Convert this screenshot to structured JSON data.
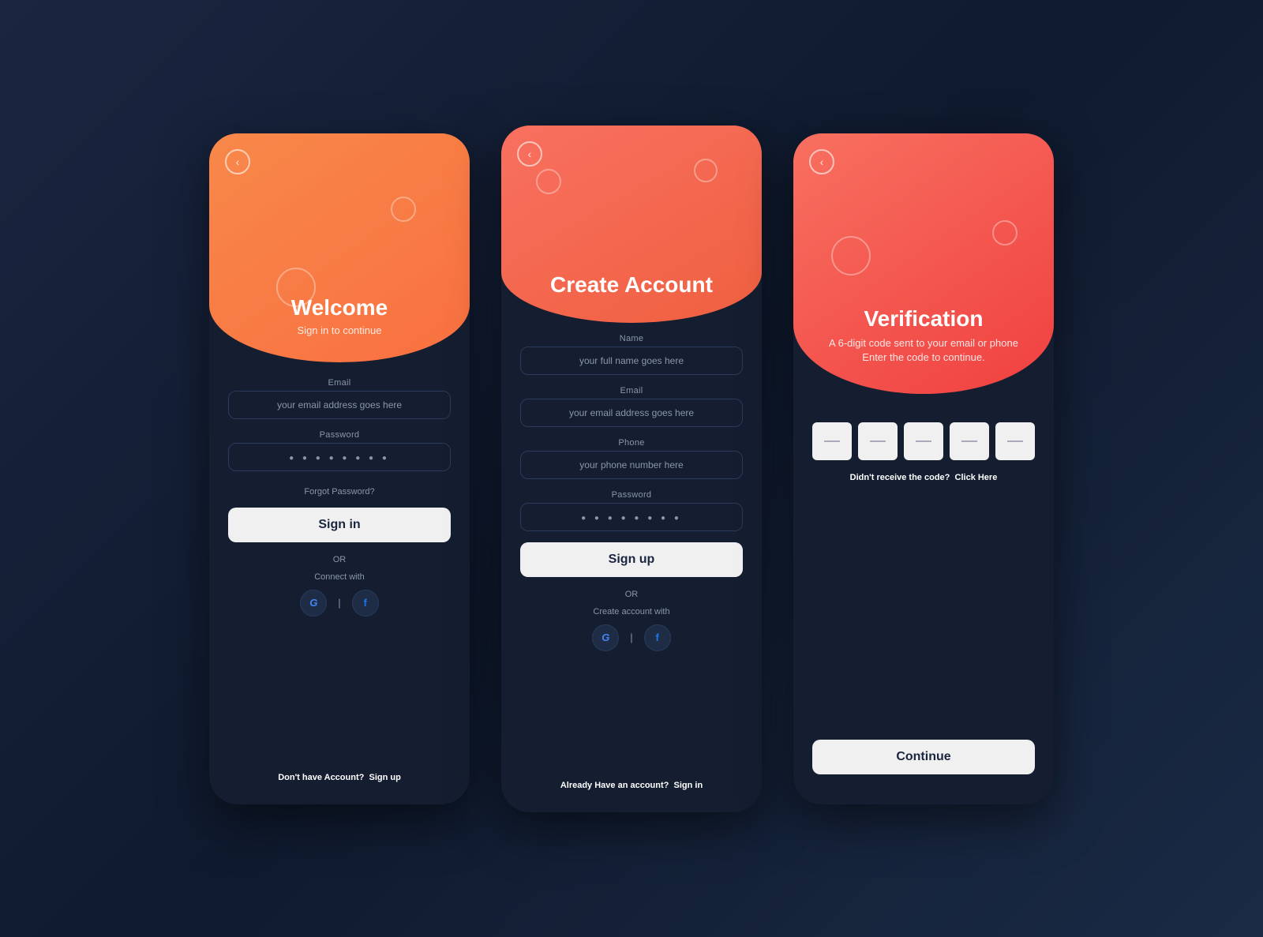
{
  "page": {
    "bg": "#0f1a2e"
  },
  "card1": {
    "back_btn": "‹",
    "title": "Welcome",
    "subtitle": "Sign in to continue",
    "email_label": "Email",
    "email_placeholder": "your email address goes here",
    "password_label": "Password",
    "password_dots": "● ● ● ● ● ● ● ●",
    "forgot_password": "Forgot Password?",
    "sign_in_btn": "Sign in",
    "or_text": "OR",
    "connect_label": "Connect with",
    "google_icon": "G",
    "facebook_icon": "f",
    "bottom_text_plain": "Don't have Account?",
    "bottom_text_link": "Sign up"
  },
  "card2": {
    "back_btn": "‹",
    "title": "Create Account",
    "name_label": "Name",
    "name_placeholder": "your full name goes here",
    "email_label": "Email",
    "email_placeholder": "your email address goes here",
    "phone_label": "Phone",
    "phone_placeholder": "your phone number here",
    "password_label": "Password",
    "password_dots": "● ● ● ● ● ● ● ●",
    "sign_up_btn": "Sign up",
    "or_text": "OR",
    "create_with": "Create account with",
    "google_icon": "G",
    "facebook_icon": "f",
    "bottom_text_plain": "Already Have an account?",
    "bottom_text_link": "Sign in"
  },
  "card3": {
    "back_btn": "‹",
    "title": "Verification",
    "subtitle_line1": "A 6-digit code sent to your email or phone",
    "subtitle_line2": "Enter the code to continue.",
    "continue_btn": "Continue",
    "resend_plain": "Didn't receive the code?",
    "resend_link": "Click Here"
  }
}
